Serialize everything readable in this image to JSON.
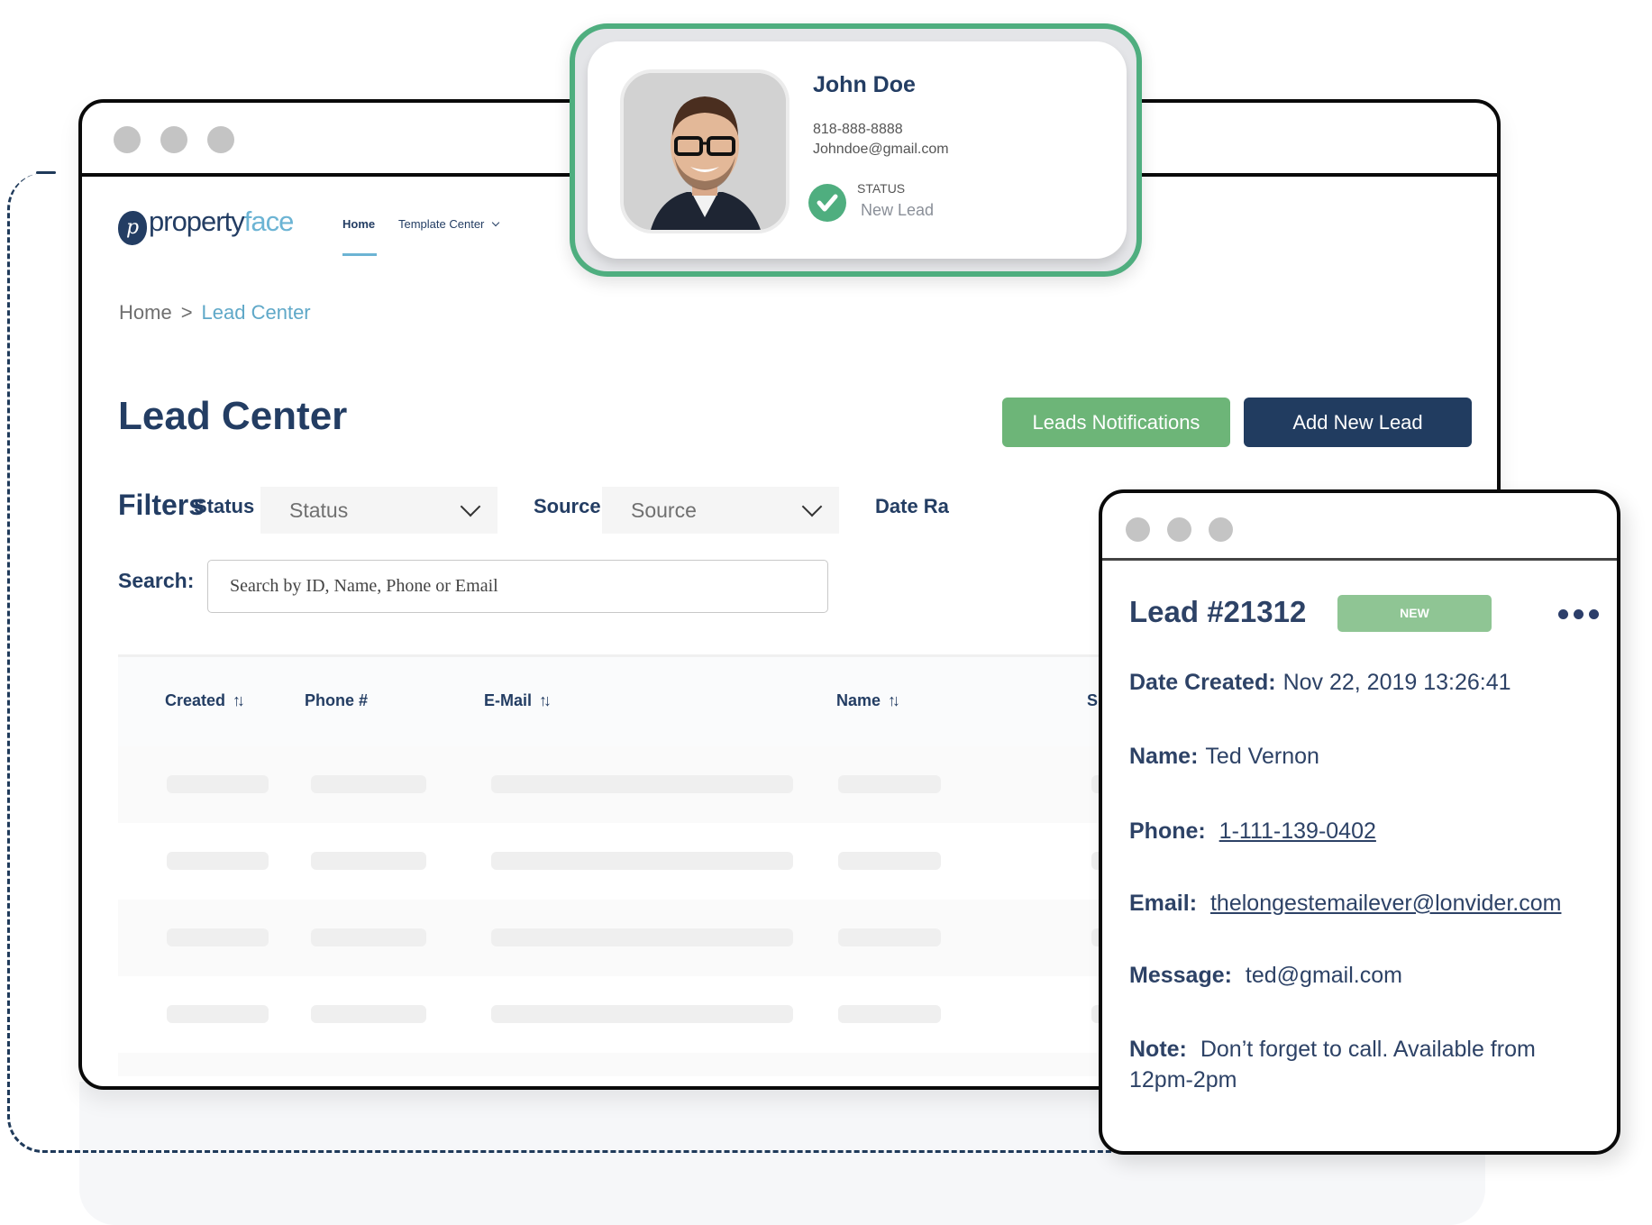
{
  "app": {
    "brand": {
      "name_part1": "property",
      "name_part2": "face",
      "logo_letter": "p"
    },
    "nav": [
      {
        "label": "Home",
        "active": true
      },
      {
        "label": "Template Center",
        "has_dropdown": true
      }
    ],
    "breadcrumb": {
      "root": "Home",
      "separator": ">",
      "current": "Lead Center"
    },
    "page_title": "Lead Center",
    "buttons": {
      "notifications": "Leads Notifications",
      "add_lead": "Add New Lead"
    },
    "filters": {
      "label": "Filters",
      "status_label": "Status",
      "status_value": "Status",
      "source_label": "Source",
      "source_value": "Source",
      "date_label": "Date Ra"
    },
    "search": {
      "label": "Search:",
      "placeholder": "Search by ID, Name, Phone or Email"
    },
    "table": {
      "columns": [
        {
          "label": "Created",
          "sortable": true
        },
        {
          "label": "Phone #",
          "sortable": false
        },
        {
          "label": "E-Mail",
          "sortable": true
        },
        {
          "label": "Name",
          "sortable": true
        },
        {
          "label": "S",
          "sortable": false
        }
      ],
      "sort_icon": "↑↓",
      "loading_rows": 4
    }
  },
  "profile_card": {
    "name": "John Doe",
    "phone": "818-888-8888",
    "email": "Johndoe@gmail.com",
    "status_caption": "STATUS",
    "status_value": "New Lead",
    "status_icon": "check-circle-icon"
  },
  "lead_card": {
    "title": "Lead #21312",
    "badge": "NEW",
    "more_icon": "more-horizontal-icon",
    "fields": {
      "date_created": {
        "label": "Date Created:",
        "value": "Nov 22, 2019 13:26:41"
      },
      "name": {
        "label": "Name:",
        "value": "Ted Vernon"
      },
      "phone": {
        "label": "Phone:",
        "value": "1-111-139-0402"
      },
      "email": {
        "label": "Email:",
        "value": "thelongestemailever@lonvider.com"
      },
      "message": {
        "label": "Message:",
        "value": "ted@gmail.com"
      },
      "note": {
        "label": "Note:",
        "value": "Don’t forget to call. Available from 12pm-2pm"
      }
    }
  },
  "colors": {
    "navy": "#233d63",
    "green_button": "#6db578",
    "profile_border": "#4fae7f",
    "badge": "#8fc594",
    "link_accent": "#5fa8c8"
  }
}
